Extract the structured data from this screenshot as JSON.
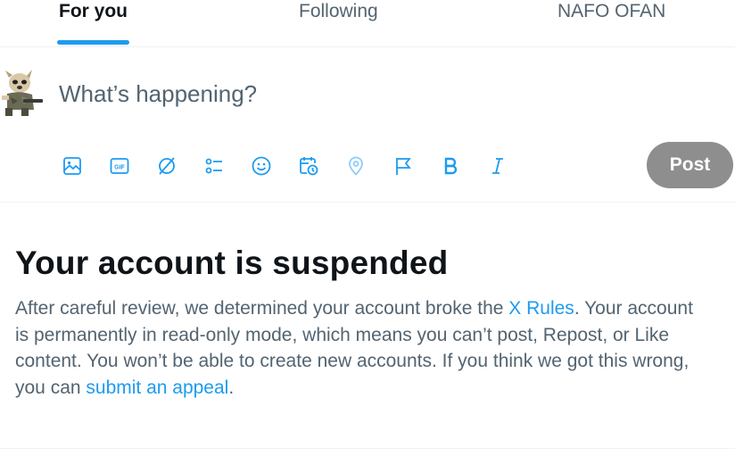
{
  "tabs": [
    {
      "label": "For you",
      "active": true
    },
    {
      "label": "Following",
      "active": false
    },
    {
      "label": "NAFO OFAN",
      "active": false
    }
  ],
  "composer": {
    "placeholder": "What’s happening?",
    "post_label": "Post",
    "toolbar_icons": [
      "media-icon",
      "gif-icon",
      "grok-icon",
      "poll-icon",
      "emoji-icon",
      "schedule-icon",
      "location-icon",
      "flag-icon",
      "bold-icon",
      "italic-icon"
    ]
  },
  "notice": {
    "title": "Your account is suspended",
    "body_1": "After careful review, we determined your account broke the ",
    "rules_link": "X Rules",
    "body_2": ". Your account is permanently in read-only mode, which means you can’t post, Repost, or Like content. You won’t be able to create new accounts. If you think we got this wrong, you can ",
    "appeal_link": "submit an appeal",
    "body_3": "."
  },
  "colors": {
    "accent": "#1d9bf0",
    "text_primary": "#0f1419",
    "text_secondary": "#536471",
    "post_button_disabled": "#8e8e8e",
    "divider": "#eff3f4"
  }
}
